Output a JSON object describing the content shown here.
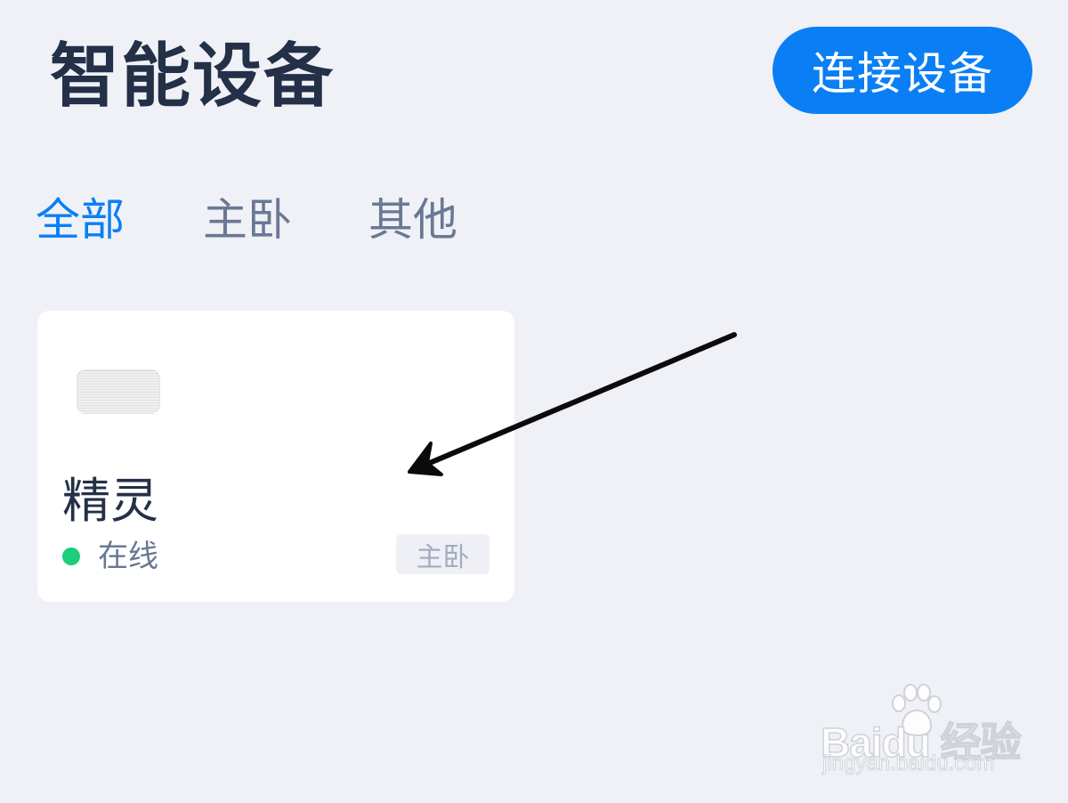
{
  "header": {
    "title": "智能设备",
    "connect_button_label": "连接设备"
  },
  "tabs": [
    {
      "label": "全部",
      "active": true
    },
    {
      "label": "主卧",
      "active": false
    },
    {
      "label": "其他",
      "active": false
    }
  ],
  "devices": [
    {
      "name": "精灵",
      "status": "在线",
      "room": "主卧"
    }
  ],
  "watermark": {
    "brand": "Baidu 经验",
    "url": "jingyan.baidu.com"
  },
  "colors": {
    "accent": "#0a7ff5",
    "background": "#eff1f7",
    "online": "#1ccd7a",
    "title_text": "#233047"
  }
}
